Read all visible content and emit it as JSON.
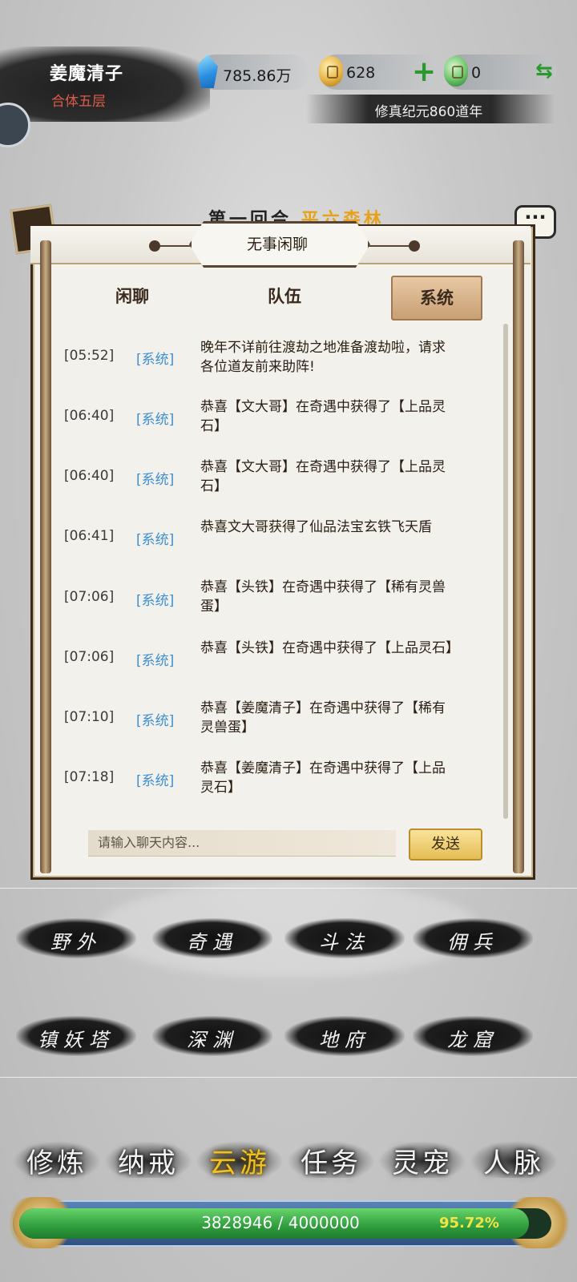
{
  "player": {
    "name": "姜魔清子",
    "realm": "合体五层"
  },
  "resources": {
    "spirit_stones": "785.86万",
    "gold": "628",
    "jade": "0",
    "era": "修真纪元860道年"
  },
  "background": {
    "title_a": "第一回合",
    "title_b": "平六森林"
  },
  "chat": {
    "title": "无事闲聊",
    "tabs": [
      "闲聊",
      "队伍",
      "系统"
    ],
    "active_tab": "系统",
    "messages": [
      {
        "time": "[05:52]",
        "tag": "[系统]",
        "text": "晚年不详前往渡劫之地准备渡劫啦，请求各位道友前来助阵!"
      },
      {
        "time": "[06:40]",
        "tag": "[系统]",
        "text": "恭喜【文大哥】在奇遇中获得了【上品灵石】"
      },
      {
        "time": "[06:40]",
        "tag": "[系统]",
        "text": "恭喜【文大哥】在奇遇中获得了【上品灵石】"
      },
      {
        "time": "[06:41]",
        "tag": "[系统]",
        "text": "恭喜文大哥获得了仙品法宝玄铁飞天盾"
      },
      {
        "time": "[07:06]",
        "tag": "[系统]",
        "text": "恭喜【头铁】在奇遇中获得了【稀有灵兽蛋】"
      },
      {
        "time": "[07:06]",
        "tag": "[系统]",
        "text": "恭喜【头铁】在奇遇中获得了【上品灵石】"
      },
      {
        "time": "[07:10]",
        "tag": "[系统]",
        "text": "恭喜【姜魔清子】在奇遇中获得了【稀有灵兽蛋】"
      },
      {
        "time": "[07:18]",
        "tag": "[系统]",
        "text": "恭喜【姜魔清子】在奇遇中获得了【上品灵石】"
      }
    ],
    "input_placeholder": "请输入聊天内容...",
    "send_label": "发送"
  },
  "actions": [
    "野外",
    "奇遇",
    "斗法",
    "佣兵",
    "镇妖塔",
    "深渊",
    "地府",
    "龙窟"
  ],
  "nav": {
    "items": [
      "修炼",
      "纳戒",
      "云游",
      "任务",
      "灵宠",
      "人脉"
    ],
    "active": "云游"
  },
  "progress": {
    "current": 3828946,
    "max": 4000000,
    "text": "3828946 / 4000000",
    "percent_label": "95.72%",
    "fraction": 0.9572
  },
  "colors": {
    "accent_gold": "#f0c21f",
    "system_tag": "#3d8fd1",
    "realm_red": "#e05a4b",
    "xp_green": "#2f9d3d"
  },
  "icons": [
    "spirit-stone-icon",
    "gold-coin-icon",
    "jade-coin-icon",
    "plus-icon",
    "swap-icon",
    "more-icon"
  ]
}
